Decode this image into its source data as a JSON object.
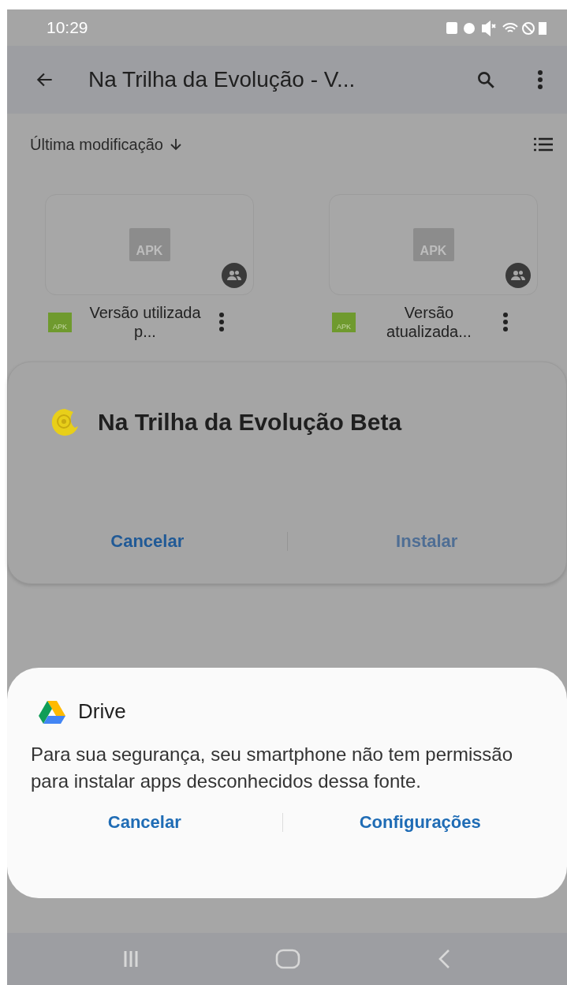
{
  "status_bar": {
    "time": "10:29"
  },
  "app_bar": {
    "title": "Na Trilha da Evolução - V..."
  },
  "sort": {
    "label": "Última modificação"
  },
  "files": [
    {
      "thumb_label": "APK",
      "type_label": "APK",
      "name": "Versão utilizada p...",
      "shared": true
    },
    {
      "thumb_label": "APK",
      "type_label": "APK",
      "name": "Versão atualizada...",
      "shared": true
    }
  ],
  "install_dialog": {
    "app_name": "Na Trilha da Evolução Beta",
    "buttons": [
      {
        "label": "Cancelar",
        "disabled": false
      },
      {
        "label": "Instalar",
        "disabled": true
      }
    ]
  },
  "drive_dialog": {
    "title": "Drive",
    "message": "Para sua segurança, seu smartphone não tem permissão para instalar apps desconhecidos dessa fonte.",
    "buttons": [
      {
        "label": "Cancelar",
        "disabled": false
      },
      {
        "label": "Configurações",
        "disabled": false
      }
    ]
  }
}
